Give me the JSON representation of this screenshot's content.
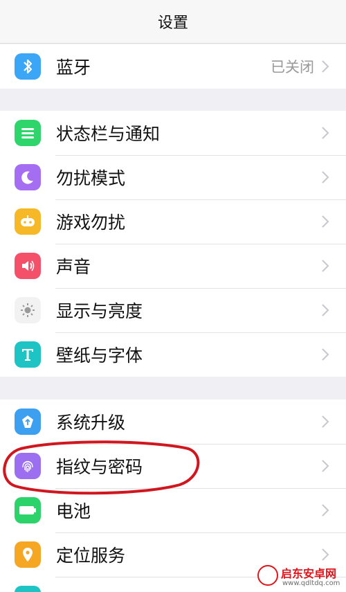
{
  "header": {
    "title": "设置"
  },
  "groups": [
    {
      "items": [
        {
          "label": "蓝牙",
          "value": "已关闭",
          "icon": "bluetooth-icon",
          "color": "#3aa6f5"
        }
      ]
    },
    {
      "items": [
        {
          "label": "状态栏与通知",
          "icon": "notification-icon",
          "color": "#2dd56b"
        },
        {
          "label": "勿扰模式",
          "icon": "moon-icon",
          "color": "#a56ef2"
        },
        {
          "label": "游戏勿扰",
          "icon": "gamepad-icon",
          "color": "#f7b827"
        },
        {
          "label": "声音",
          "icon": "speaker-icon",
          "color": "#f4506a"
        },
        {
          "label": "显示与亮度",
          "icon": "brightness-icon",
          "color": "#a9a9a9"
        },
        {
          "label": "壁纸与字体",
          "icon": "font-t-icon",
          "color": "#1ec4c4"
        }
      ]
    },
    {
      "items": [
        {
          "label": "系统升级",
          "icon": "system-update-icon",
          "color": "#3c9ff0"
        },
        {
          "label": "指纹与密码",
          "icon": "fingerprint-icon",
          "color": "#9b6ff0"
        },
        {
          "label": "电池",
          "icon": "battery-icon",
          "color": "#2bd36a"
        },
        {
          "label": "定位服务",
          "icon": "location-icon",
          "color": "#f5a623"
        }
      ]
    }
  ],
  "watermark": {
    "brand": "启东安卓网",
    "url": "www.qdltdq.com"
  }
}
